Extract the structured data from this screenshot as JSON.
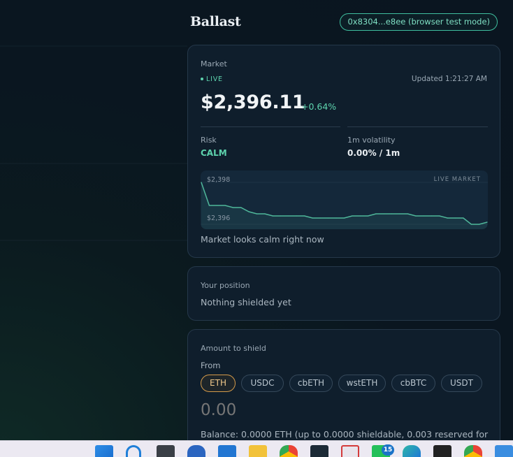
{
  "header": {
    "brand": "Ballast",
    "wallet": "0x8304...e8ee (browser test mode)"
  },
  "market": {
    "title": "Market",
    "live_label": "LIVE",
    "updated": "Updated 1:21:27 AM",
    "price": "$2,396.11",
    "change": "+0.64%",
    "risk_label": "Risk",
    "risk_value": "CALM",
    "volatility_label": "1m volatility",
    "volatility_value": "0.00% / 1m",
    "chart_tag": "LIVE MARKET",
    "note": "Market looks calm right now"
  },
  "chart_data": {
    "type": "line",
    "title": "",
    "xlabel": "",
    "ylabel": "",
    "ylim": [
      2395.9,
      2398.1
    ],
    "yticks": [
      "$2,398",
      "$2,396"
    ],
    "series": [
      {
        "values": [
          2398.0,
          2396.9,
          2396.9,
          2396.9,
          2396.8,
          2396.8,
          2396.6,
          2396.5,
          2396.5,
          2396.4,
          2396.4,
          2396.4,
          2396.4,
          2396.4,
          2396.3,
          2396.3,
          2396.3,
          2396.3,
          2396.3,
          2396.4,
          2396.4,
          2396.4,
          2396.5,
          2396.5,
          2396.5,
          2396.5,
          2396.5,
          2396.4,
          2396.4,
          2396.4,
          2396.4,
          2396.3,
          2396.3,
          2396.3,
          2396.0,
          2396.0,
          2396.1
        ],
        "color": "#4fb79a"
      }
    ],
    "grid": false,
    "legend": "none"
  },
  "position": {
    "title": "Your position",
    "value": "Nothing shielded yet"
  },
  "amount": {
    "title": "Amount to shield",
    "from_label": "From",
    "tokens": [
      "ETH",
      "USDC",
      "cbETH",
      "wstETH",
      "cbBTC",
      "USDT"
    ],
    "selected_token": "ETH",
    "placeholder": "0.00",
    "balance": "Balance: 0.0000 ETH (up to 0.0000 shieldable, 0.003 reserved for"
  },
  "taskbar": {
    "notification_count": "15",
    "icons": [
      "windows-start-icon",
      "search-icon",
      "task-view-icon",
      "app-icon",
      "store-icon",
      "file-explorer-icon",
      "chrome-icon",
      "terminal-icon",
      "snipping-tool-icon",
      "whatsapp-icon",
      "edge-icon",
      "app-dark-icon",
      "chrome-profile-icon",
      "photos-icon"
    ]
  },
  "colors": {
    "accent": "#5ed4ae",
    "chip_active": "#d49a4a",
    "background": "#0a1620",
    "card": "#0f1e2c"
  }
}
